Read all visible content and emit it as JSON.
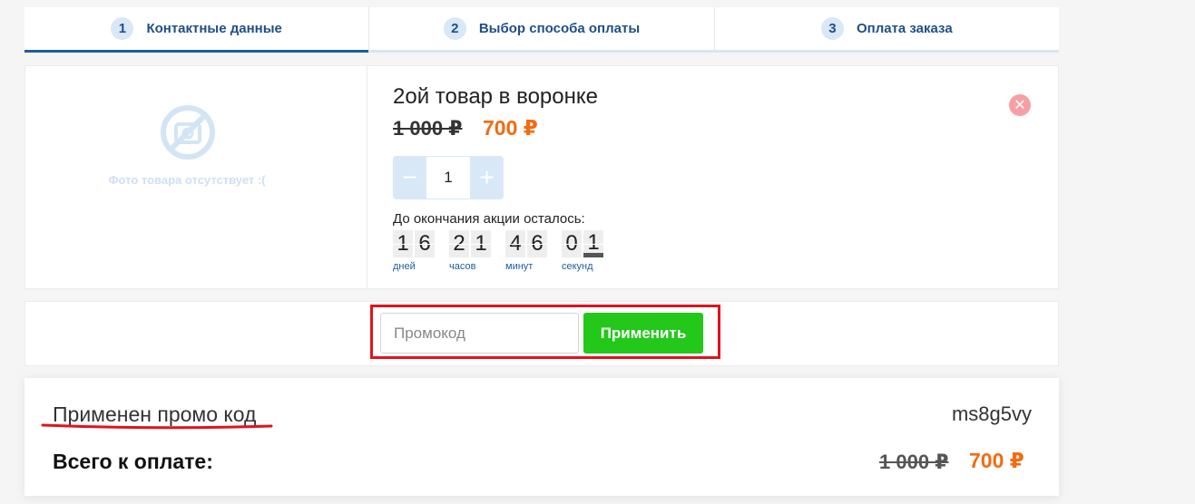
{
  "steps": [
    {
      "num": "1",
      "label": "Контактные данные"
    },
    {
      "num": "2",
      "label": "Выбор способа оплаты"
    },
    {
      "num": "3",
      "label": "Оплата заказа"
    }
  ],
  "product": {
    "photo_placeholder": "Фото товара отсутствует :(",
    "name": "2ой товар в воронке",
    "old_price": "1 000 ₽",
    "new_price": "700 ₽",
    "quantity": "1",
    "minus_label": "−",
    "plus_label": "+",
    "remove_label": "✕"
  },
  "timer": {
    "title": "До окончания акции осталось:",
    "days": {
      "digits": [
        "1",
        "6"
      ],
      "label": "дней"
    },
    "hours": {
      "digits": [
        "2",
        "1"
      ],
      "label": "часов"
    },
    "minutes": {
      "digits": [
        "4",
        "6"
      ],
      "label": "минут"
    },
    "seconds": {
      "digits": [
        "0",
        "1"
      ],
      "label": "секунд"
    }
  },
  "promo": {
    "placeholder": "Промокод",
    "apply_label": "Применить"
  },
  "summary": {
    "applied_label": "Применен промо код",
    "code": "ms8g5vy",
    "total_label": "Всего к оплате:",
    "total_old": "1 000 ₽",
    "total_new": "700 ₽"
  },
  "colors": {
    "accent_blue": "#1f4f86",
    "price_orange": "#f36b12",
    "apply_green": "#23c81a",
    "highlight_red": "#e3121b"
  }
}
